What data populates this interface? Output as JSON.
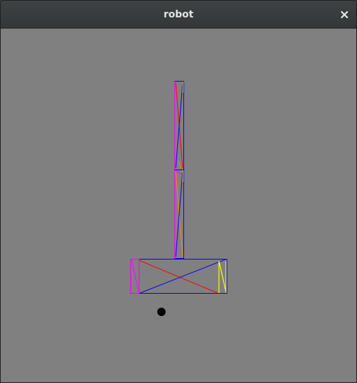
{
  "window": {
    "title": "robot",
    "close_icon": "close-icon"
  },
  "canvas": {
    "background_color": "#808080",
    "colors": {
      "magenta": "#ff00ff",
      "blue": "#0000ff",
      "red": "#ff0000",
      "yellow": "#ffff00",
      "orange": "#ff8800",
      "black": "#000000"
    }
  }
}
